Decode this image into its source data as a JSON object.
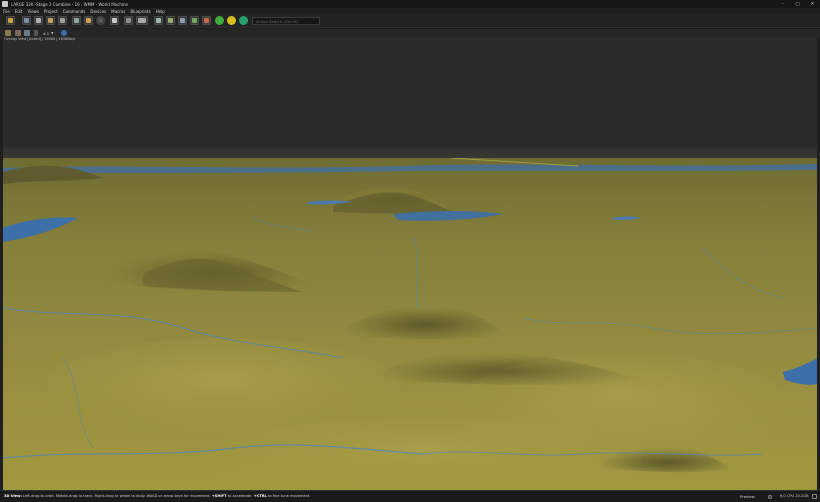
{
  "window": {
    "title": "LARGE 32K -Stage 2 Combine - 16 - WMM - World Machine",
    "controls": {
      "minimize": "–",
      "maximize": "□",
      "close": "✕"
    }
  },
  "menu": [
    "File",
    "Edit",
    "Views",
    "Project",
    "Commands",
    "Devices",
    "Macros",
    "Blueprints",
    "Help"
  ],
  "toolbar": {
    "search_placeholder": "Action Search (Ctrl+E)",
    "icons": [
      "open-project-icon",
      "save-icon",
      "build-icon",
      "cancel-build-icon",
      "export-icon",
      "tile-build-icon",
      "explore-icon",
      "render-icon",
      "layout-icon",
      "grid-icon",
      "view-mode-icon",
      "device-view-icon",
      "terrain-view-icon",
      "split-view-icon",
      "image-view-icon",
      "map-view-icon",
      "green-globe-icon",
      "yellow-globe-icon",
      "teal-globe-icon"
    ],
    "accent_colors": {
      "green": "#3fae3f",
      "yellow": "#d8c020",
      "teal": "#2a9e6a"
    }
  },
  "viewport_toolbar": {
    "zoom_value": "4:1"
  },
  "overlay_info": "Overlay View [locked] | 16384 | 1638Mb/s",
  "status": {
    "mode_label": "3D View:",
    "hint_part1": "Left-drag to orbit. Middle-drag to track. Right-drag or wheel to dolly. WASD or arrow keys for movement.",
    "shift_key": "+SHIFT",
    "hint_part2": "to accelerate.",
    "ctrl_key": "+CTRL",
    "hint_part3": "to fine tune movement.",
    "preview_label": "Preview",
    "cpu_text": "6.0 CPU 20.2GB"
  },
  "colors": {
    "terrain_base": "#8a8a3c",
    "terrain_light": "#a39c4a",
    "terrain_dark": "#6d6a2e",
    "water": "#3d6fa8",
    "river": "#4f86b8",
    "background": "#2b2b2b"
  }
}
